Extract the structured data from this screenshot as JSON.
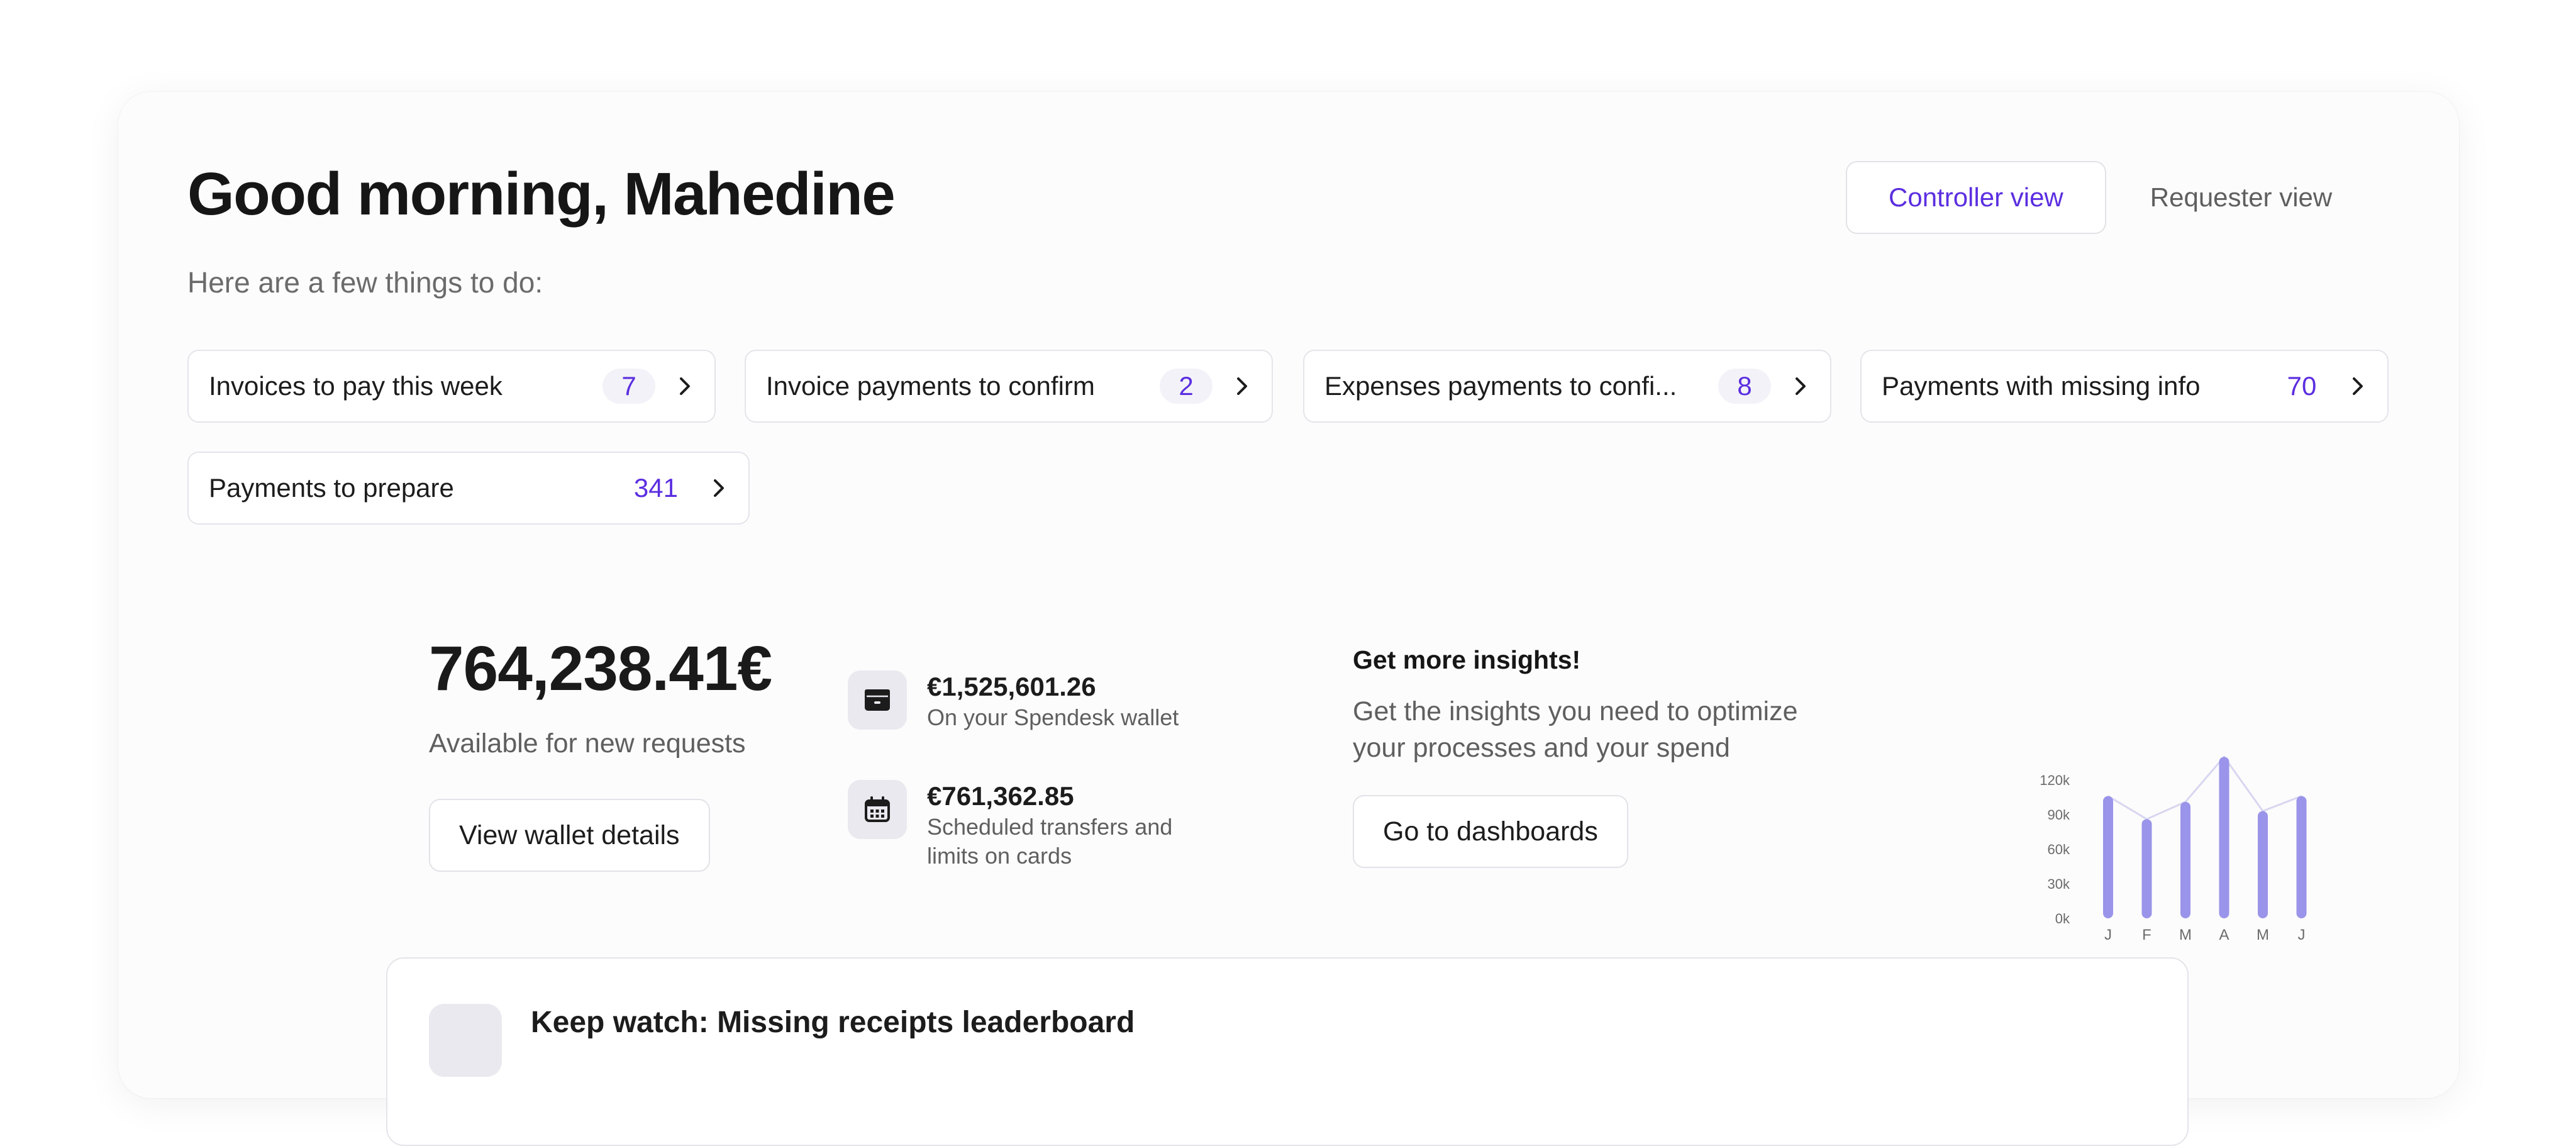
{
  "header": {
    "greeting": "Good morning, Mahedine",
    "subtitle": "Here are a few things to do:"
  },
  "view_toggle": {
    "controller": "Controller view",
    "requester": "Requester view",
    "active": "controller"
  },
  "todos": [
    {
      "label": "Invoices to pay this week",
      "count": "7"
    },
    {
      "label": "Invoice payments to confirm",
      "count": "2"
    },
    {
      "label": "Expenses payments to confi...",
      "count": "8"
    },
    {
      "label": "Payments with missing info",
      "count": "70"
    },
    {
      "label": "Payments to prepare",
      "count": "341"
    }
  ],
  "wallet": {
    "balance": "764,238.41€",
    "caption": "Available for new requests",
    "button": "View wallet details"
  },
  "stats": [
    {
      "value": "€1,525,601.26",
      "label": "On your Spendesk wallet",
      "icon": "wallet-icon"
    },
    {
      "value": "€761,362.85",
      "label": "Scheduled transfers and limits on cards",
      "icon": "calendar-icon"
    }
  ],
  "insights": {
    "title": "Get more insights!",
    "text": "Get the insights you need to optimize your processes and your spend",
    "button": "Go to dashboards"
  },
  "chart_data": {
    "type": "bar",
    "categories": [
      "J",
      "F",
      "M",
      "A",
      "M",
      "J"
    ],
    "values": [
      106000,
      86000,
      101000,
      140000,
      93000,
      106000
    ],
    "y_ticks": [
      "120k",
      "90k",
      "60k",
      "30k",
      "0k"
    ],
    "ylim": [
      0,
      120000
    ],
    "title": "",
    "xlabel": "",
    "ylabel": "",
    "bar_color": "#9a94ea",
    "line_color": "#d8d6f0"
  },
  "leaderboard": {
    "title": "Keep watch: Missing receipts leaderboard"
  },
  "colors": {
    "accent": "#5b2ee0",
    "bar": "#9a94ea"
  }
}
